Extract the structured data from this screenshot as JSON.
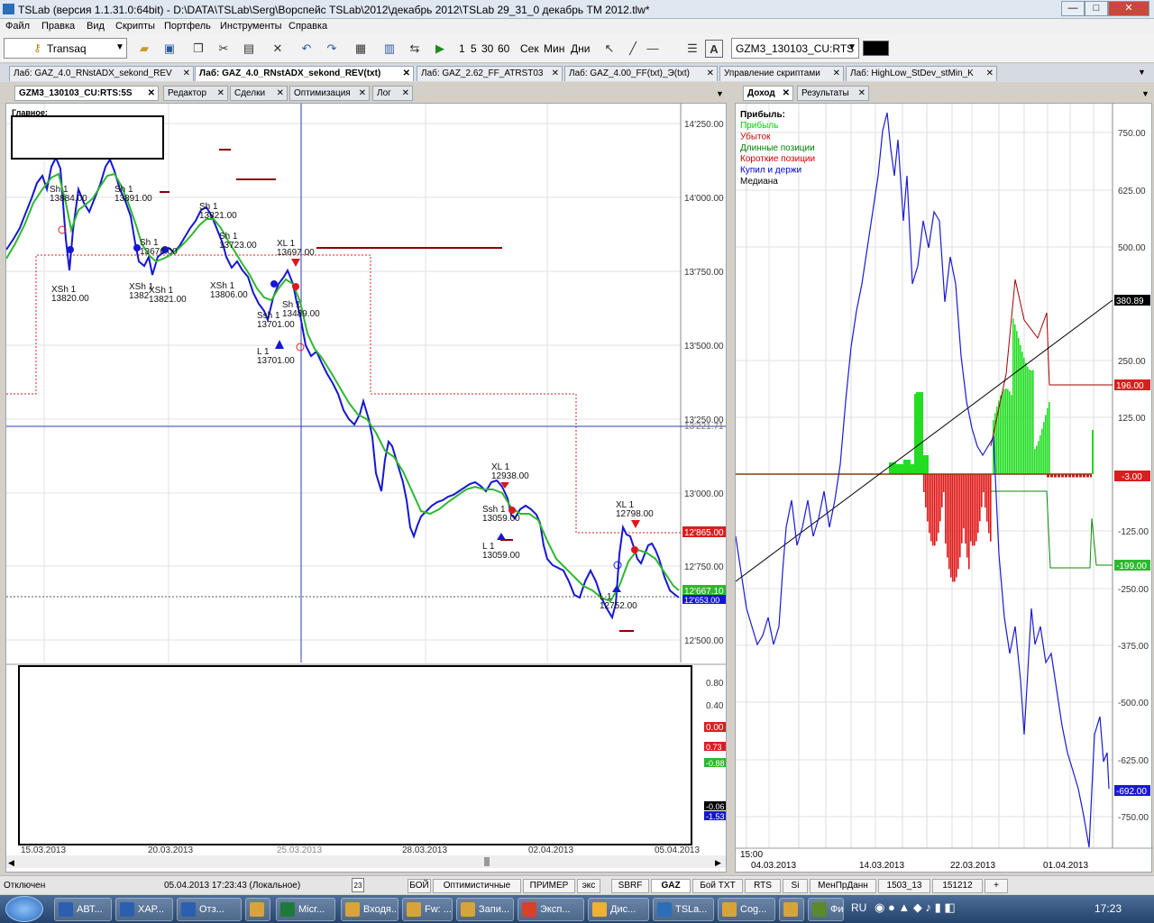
{
  "window": {
    "title": "TSLab (версия 1.1.31.0:64bit) - D:\\DATA\\TSLab\\Serg\\Ворспейс TSLab\\2012\\декабрь 2012\\TSLab 29_31_0 декабрь ТМ 2012.tlw*",
    "minimize": "—",
    "maximize": "□",
    "close": "✕"
  },
  "menu": [
    "Файл",
    "Правка",
    "Вид",
    "Скрипты",
    "Портфель",
    "Инструменты",
    "Справка"
  ],
  "toolbar": {
    "provider": "Transaq",
    "intervals": [
      "1",
      "5",
      "30",
      "60"
    ],
    "units": [
      "Сек",
      "Мин",
      "Дни"
    ],
    "instrument": "GZM3_130103_CU:RTS"
  },
  "doc_tabs": [
    "Лаб: GAZ_4.0_RNstADX_sekond_REV",
    "Лаб: GAZ_4.0_RNstADX_sekond_REV(txt)",
    "Лаб: GAZ_2.62_FF_ATRST03",
    "Лаб: GAZ_4.00_FF(txt)_Э(txt)",
    "Управление скриптами",
    "Лаб: HighLow_StDev_stMin_K"
  ],
  "left_tabs": [
    "GZM3_130103_CU:RTS:5S",
    "Редактор",
    "Сделки",
    "Оптимизация",
    "Лог"
  ],
  "right_tabs": [
    "Доход",
    "Результаты"
  ],
  "price_chart": {
    "pane_title": "Главное:",
    "y_ticks": [
      "14'250.00",
      "14'000.00",
      "13'750.00",
      "13'500.00",
      "13'250.00",
      "13'000.00",
      "12'750.00",
      "12'500.00"
    ],
    "crosshair_label": "13'221.71",
    "marker_red": "12'865.00",
    "marker_green": "12'667.10",
    "marker_blue": "12'653.00",
    "x_dates": [
      "15.03.2013",
      "20.03.2013",
      "25.03.2013",
      "28.03.2013",
      "02.04.2013",
      "05.04.2013"
    ],
    "annotations": [
      "Sh 1",
      "13884.00",
      "Sh 1",
      "13891.00",
      "Sh 1",
      "13821.00",
      "Sh 1",
      "13676.00",
      "Sh 1",
      "13723.00",
      "XL 1",
      "13697.00",
      "XSh 1",
      "13820.00",
      "XSh 1",
      "1382",
      "XSh 1",
      "13821.00",
      "XSh 1",
      "13806.00",
      "Sh 1",
      "13489.00",
      "Ssh 1",
      "13701.00",
      "L 1",
      "13701.00",
      "XL 1",
      "12938.00",
      "Ssh 1",
      "13059.00",
      "L 1",
      "13059.00",
      "XL 1",
      "12798.00",
      "L 1",
      "12752.00"
    ]
  },
  "indicator_pane": {
    "ticks": [
      "0.80",
      "0.40",
      "0.00"
    ],
    "labels_red": [
      "0.00",
      "0.73"
    ],
    "labels_green": [
      "-0.88"
    ],
    "labels_blue": [
      "-1.53"
    ],
    "labels_black": [
      "-0.06"
    ]
  },
  "profit_chart": {
    "legend_title": "Прибыль:",
    "legend": [
      {
        "label": "Прибыль",
        "color": "#00cc00"
      },
      {
        "label": "Убыток",
        "color": "#cc0000"
      },
      {
        "label": "Длинные позиции",
        "color": "#008000"
      },
      {
        "label": "Короткие позиции",
        "color": "#cc0000"
      },
      {
        "label": "Купил и держи",
        "color": "#0000cc"
      },
      {
        "label": "Медиана",
        "color": "#000000"
      }
    ],
    "y_ticks": [
      "750.00",
      "625.00",
      "500.00",
      "380.89",
      "250.00",
      "196.00",
      "125.00",
      "-3.00",
      "-125.00",
      "-199.00",
      "-250.00",
      "-375.00",
      "-500.00",
      "-625.00",
      "-692.00",
      "-750.00"
    ],
    "x_dates": [
      "04.03.2013",
      "14.03.2013",
      "22.03.2013",
      "01.04.2013"
    ],
    "time_label": "15:00"
  },
  "status": {
    "connection": "Отключен",
    "datetime": "05.04.2013 17:23:43 (Локальное)",
    "calendar": "23"
  },
  "bottom_tabs": [
    "БОЙ",
    "Оптимистичные",
    "ПРИМЕР",
    "экс",
    "SBRF",
    "GAZ",
    "Бой TXT",
    "RTS",
    "Si",
    "МенПрДанн",
    "1503_13",
    "151212",
    "+"
  ],
  "taskbar": {
    "items": [
      "АВТ...",
      "ХАР...",
      "Отз...",
      "",
      "Micr...",
      "Входя...",
      "Fw: ...",
      "Запи...",
      "Эксп...",
      "Дис...",
      "TSLa...",
      "Cog...",
      "",
      "Фин..."
    ],
    "lang": "RU",
    "clock": "17:23"
  }
}
